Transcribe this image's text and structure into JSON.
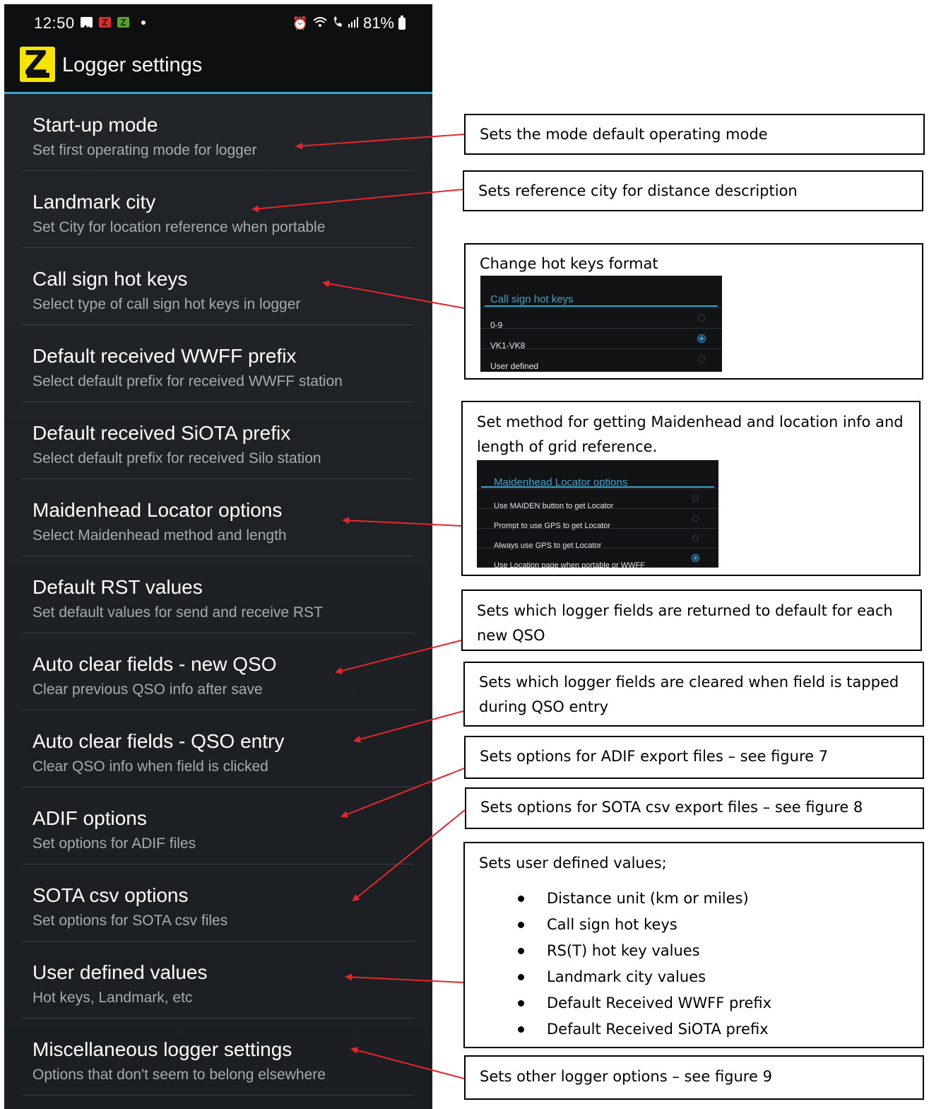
{
  "status_bar": {
    "time": "12:50",
    "battery": "81%",
    "colors": {
      "notif_red": "#d6302a",
      "notif_green": "#5aa02c"
    },
    "icons": [
      "gallery-icon",
      "z-red-app-icon",
      "z-green-app-icon",
      "alarm-icon",
      "wifi-icon",
      "call-icon",
      "signal-icon",
      "battery-icon"
    ]
  },
  "app_bar": {
    "title": "Logger settings",
    "accent": "#3ea3c8",
    "logo_color": "#f4e400"
  },
  "settings": [
    {
      "title": "Start-up mode",
      "subtitle": "Set first operating mode for logger"
    },
    {
      "title": "Landmark city",
      "subtitle": "Set City for location reference when portable"
    },
    {
      "title": "Call sign hot keys",
      "subtitle": "Select type of call sign hot keys in logger"
    },
    {
      "title": "Default received WWFF prefix",
      "subtitle": "Select default prefix for received WWFF station"
    },
    {
      "title": "Default received SiOTA prefix",
      "subtitle": "Select default prefix for received Silo station"
    },
    {
      "title": "Maidenhead Locator options",
      "subtitle": "Select Maidenhead method and length"
    },
    {
      "title": "Default RST values",
      "subtitle": "Set default values for send and receive RST"
    },
    {
      "title": "Auto clear fields - new QSO",
      "subtitle": "Clear previous QSO info after save"
    },
    {
      "title": "Auto clear fields - QSO entry",
      "subtitle": "Clear QSO info when field is clicked"
    },
    {
      "title": "ADIF options",
      "subtitle": "Set options for ADIF files"
    },
    {
      "title": "SOTA csv options",
      "subtitle": "Set options for SOTA csv files"
    },
    {
      "title": "User defined values",
      "subtitle": "Hot keys, Landmark, etc"
    },
    {
      "title": "Miscellaneous logger settings",
      "subtitle": "Options that don't seem to belong elsewhere"
    }
  ],
  "annotations": {
    "startup": "Sets the mode default operating mode",
    "landmark": "Sets reference city for distance description",
    "hotkeys": "Change hot keys format",
    "maidenhead": "Set method for getting Maidenhead and location info and length of grid reference.",
    "autoclear_new": "Sets which logger fields are returned to default for each new QSO",
    "autoclear_entry": "Sets which logger fields are cleared when field is tapped during QSO entry",
    "adif": "Sets options for ADIF export files – see figure 7",
    "sota": "Sets options for SOTA csv export files – see figure 8",
    "user_values_intro": "Sets user defined values;",
    "user_values_items": [
      "Distance unit (km or miles)",
      "Call sign hot keys",
      "RS(T) hot key values",
      "Landmark city values",
      "Default Received WWFF prefix",
      "Default Received SiOTA prefix"
    ],
    "misc": "Sets other logger options – see figure 9"
  },
  "hotkeys_dialog": {
    "title": "Call sign hot keys",
    "options": [
      "0-9",
      "VK1-VK8",
      "User defined"
    ],
    "selected": 1
  },
  "maidenhead_dialog": {
    "title": "Maidenhead Locator options",
    "options": [
      "Use MAIDEN button to get Locator",
      "Prompt to use GPS to get Locator",
      "Always use GPS to get Locator",
      "Use Location page when portable or WWFF"
    ],
    "selected": 3
  },
  "arrow_color": "#e8262a"
}
